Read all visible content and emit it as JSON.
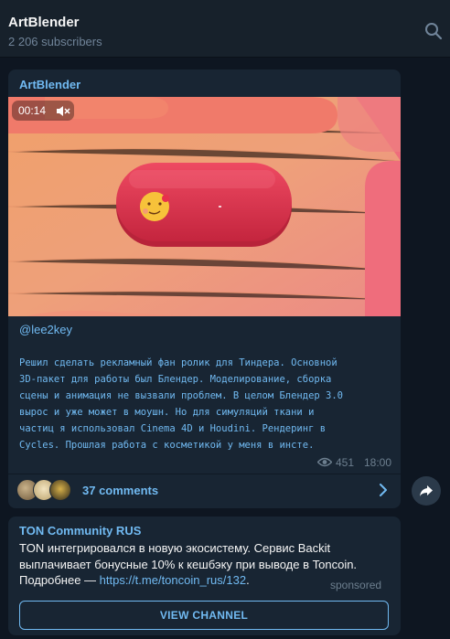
{
  "header": {
    "title": "ArtBlender",
    "subscribers": "2 206 subscribers",
    "search_icon": "search-icon"
  },
  "post": {
    "author": "ArtBlender",
    "video": {
      "duration": "00:14",
      "mute_icon": "speaker-muted-icon"
    },
    "mention": "@lee2key",
    "text": "Решил сделать рекламный фан ролик для Тиндера. Основной\n3D-пакет для работы был Блендер. Моделирование, сборка\nсцены и анимация не вызвали проблем. В целом Блендер 3.0\nвырос и уже может в моушн. Но для симуляций ткани и\nчастиц я использовал Cinema 4D и Houdini. Рендеринг в\nCycles. Прошлая работа с косметикой у меня в инсте.",
    "views": "451",
    "time": "18:00",
    "comments": "37 comments"
  },
  "sponsored": {
    "title": "TON Community RUS",
    "text": "TON интегрировался в новую экосистему. Сервис Backit выплачивает бонусные 10% к кешбэку при выводе в Toncoin. Подробнее — ",
    "link": "https://t.me/toncoin_rus/132",
    "link_suffix": ".",
    "label": "sponsored",
    "button": "VIEW CHANNEL"
  },
  "colors": {
    "background": "#0e1621",
    "card": "#182533",
    "accent": "#71baf2",
    "muted": "#6d7f8f"
  }
}
